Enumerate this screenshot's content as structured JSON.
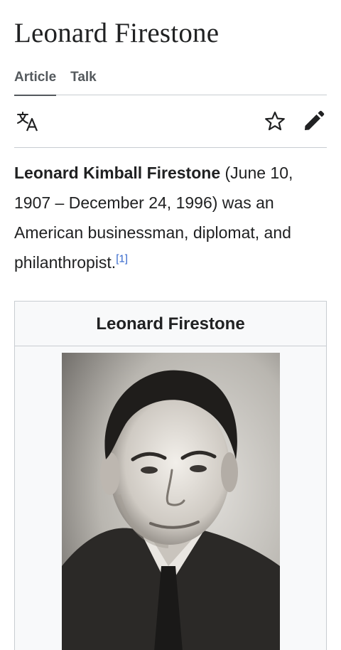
{
  "page": {
    "title": "Leonard Firestone"
  },
  "tabs": [
    {
      "label": "Article",
      "active": true
    },
    {
      "label": "Talk",
      "active": false
    }
  ],
  "toolbar": {
    "icons": [
      "language-icon",
      "star-icon",
      "edit-pencil-icon"
    ]
  },
  "lead": {
    "bold_name": "Leonard Kimball Firestone",
    "text": " (June 10, 1907 – December 24, 1996) was an American businessman, diplomat, and philanthropist.",
    "ref": "[1]"
  },
  "infobox": {
    "title": "Leonard Firestone"
  },
  "colors": {
    "text": "#202122",
    "tab_text": "#54595d",
    "link": "#3366cc",
    "divider": "#c8ccd1",
    "infobox_bg": "#f8f9fa"
  }
}
